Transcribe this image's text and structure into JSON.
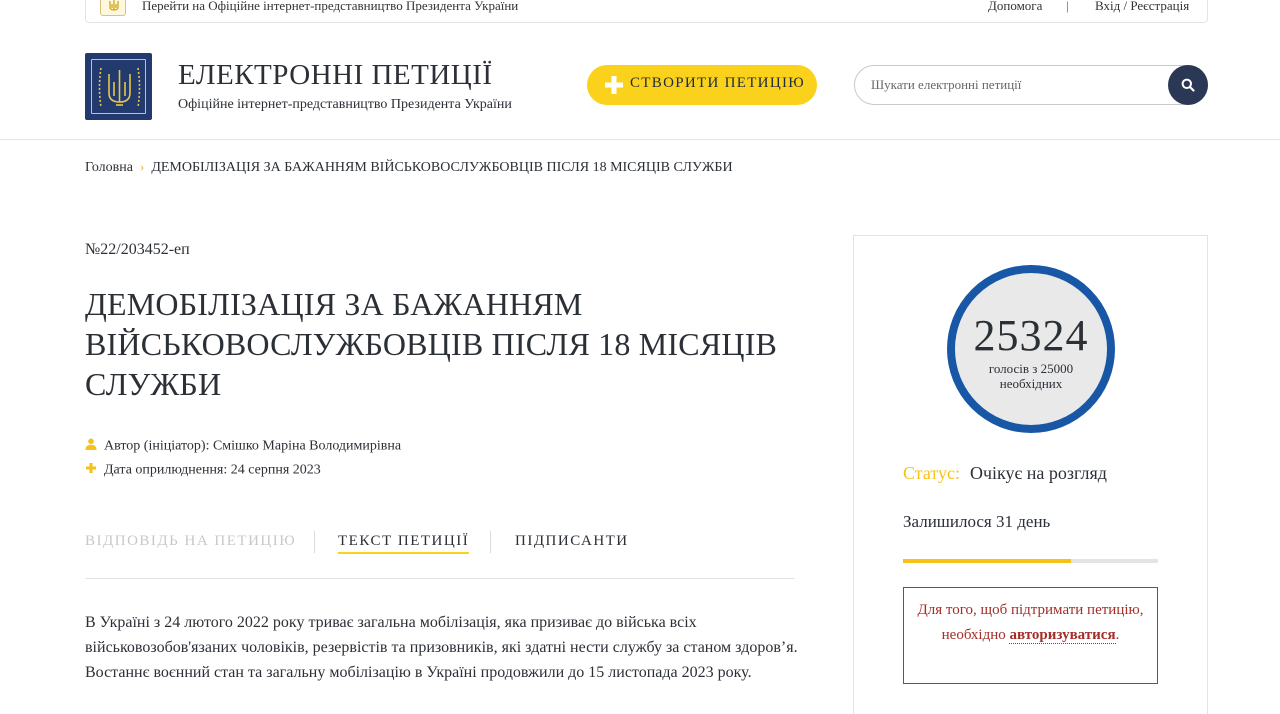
{
  "topbar": {
    "office_link": "Перейти на Офіційне інтернет-представництво Президента України",
    "help": "Допомога",
    "separator": "|",
    "login": "Вхід / Реєстрація"
  },
  "header": {
    "title": "ЕЛЕКТРОННІ ПЕТИЦІЇ",
    "subtitle": "Офіційне інтернет-представництво Президента України",
    "create_button": "СТВОРИТИ ПЕТИЦІЮ",
    "search_placeholder": "Шукати електронні петиції"
  },
  "breadcrumb": {
    "home": "Головна",
    "separator": "›",
    "current": "ДЕМОБІЛІЗАЦІЯ ЗА БАЖАННЯМ ВІЙСЬКОВОСЛУЖБОВЦІВ ПІСЛЯ 18 МІСЯЦІВ СЛУЖБИ"
  },
  "petition": {
    "number": "№22/203452-еп",
    "title": "ДЕМОБІЛІЗАЦІЯ ЗА БАЖАННЯМ ВІЙСЬКОВОСЛУЖБОВЦІВ ПІСЛЯ 18 МІСЯЦІВ СЛУЖБИ",
    "author": "Автор (ініціатор): Смішко Маріна Володимирівна",
    "date": "Дата оприлюднення: 24 серпня 2023",
    "tabs": {
      "answer": "ВІДПОВІДЬ НА ПЕТИЦІЮ",
      "text": "ТЕКСТ ПЕТИЦІЇ",
      "signers": "ПІДПИСАНТИ"
    },
    "body": "В Україні з 24 лютого 2022 року триває загальна мобілізація, яка призиває до війська всіх військовозобов'язаних чоловіків, резервістів та призовників, які здатні нести службу за станом здоров’я. Востаннє воєнний стан та загальну мобілізацію в Україні продовжили до 15 листопада 2023 року."
  },
  "sidebar": {
    "votes": "25324",
    "votes_caption": "голосів з 25000 необхідних",
    "status_label": "Статус:",
    "status_value": "Очікує на розгляд",
    "days_left": "Залишилося 31 день",
    "progress_fraction": 0.66,
    "auth_text_before": "Для того, щоб підтримати петицію, необхідно ",
    "auth_link": "авторизуватися",
    "auth_text_after": "."
  },
  "colors": {
    "accent_yellow": "#fbd21b",
    "navy": "#2a3755",
    "counter_ring": "#1857a6",
    "auth_red": "#a32f29"
  },
  "icons": {
    "emblem": "trident-emblem-icon",
    "create": "plus-icon",
    "search": "search-icon",
    "author": "user-icon",
    "date": "plus-icon"
  }
}
